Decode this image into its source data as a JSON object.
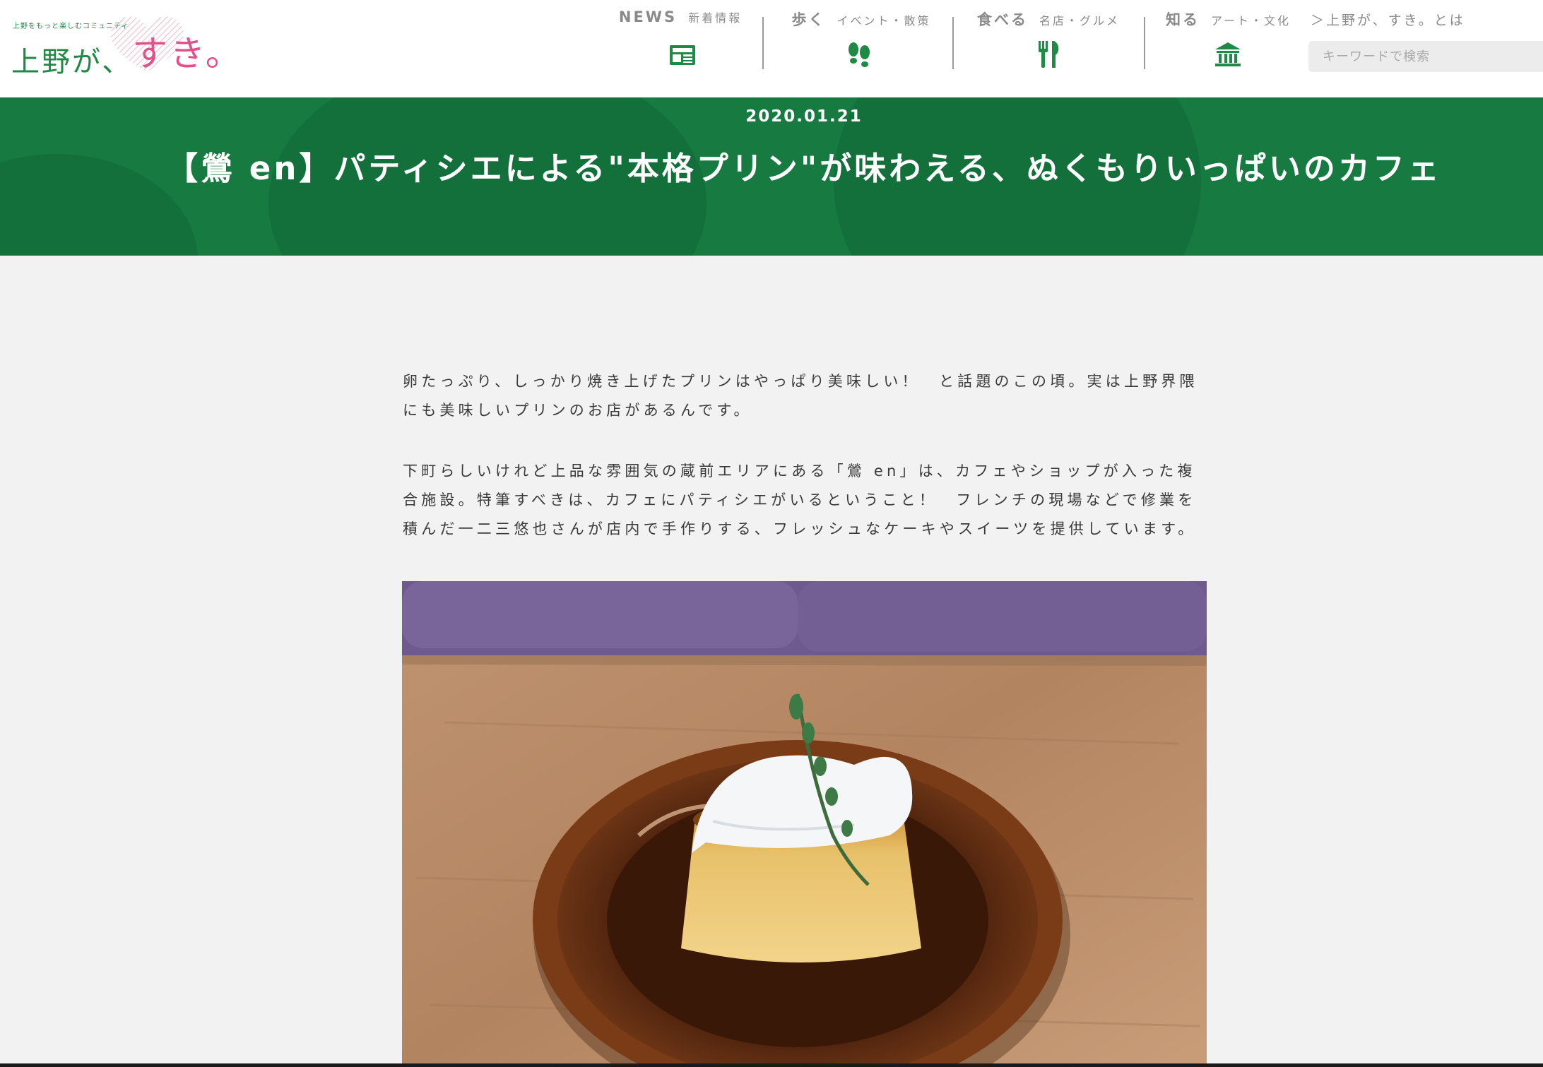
{
  "header": {
    "logo": {
      "tagline": "上野をもっと楽しむコミュニティ",
      "main": "上野が、",
      "accent": "すき。"
    },
    "nav": [
      {
        "title": "NEWS",
        "subtitle": "新着情報",
        "icon": "newspaper-icon"
      },
      {
        "title": "歩く",
        "subtitle": "イベント・散策",
        "icon": "footprints-icon"
      },
      {
        "title": "食べる",
        "subtitle": "名店・グルメ",
        "icon": "fork-knife-icon"
      },
      {
        "title": "知る",
        "subtitle": "アート・文化",
        "icon": "museum-icon"
      }
    ],
    "about_link": "＞上野が、すき。とは",
    "search": {
      "placeholder": "キーワードで検索",
      "value": ""
    }
  },
  "banner": {
    "date": "2020.01.21",
    "title": "【鶯 en】パティシエによる\"本格プリン\"が味わえる、ぬくもりいっぱいのカフェ"
  },
  "article": {
    "paragraphs": [
      "卵たっぷり、しっかり焼き上げたプリンはやっぱり美味しい！　と話題のこの頃。実は上野界隈にも美味しいプリンのお店があるんです。",
      "下町らしいけれど上品な雰囲気の蔵前エリアにある「鶯 en」は、カフェやショップが入った複合施設。特筆すべきは、カフェにパティシエがいるということ！　フレンチの現場などで修業を積んだ一二三悠也さんが店内で手作りする、フレッシュなケーキやスイーツを提供しています。"
    ]
  },
  "colors": {
    "brand_green": "#1e8a45",
    "banner_green": "#167a41",
    "logo_pink": "#e0508a",
    "page_bg": "#f2f2f2",
    "nav_gray": "#8a8a8a"
  }
}
